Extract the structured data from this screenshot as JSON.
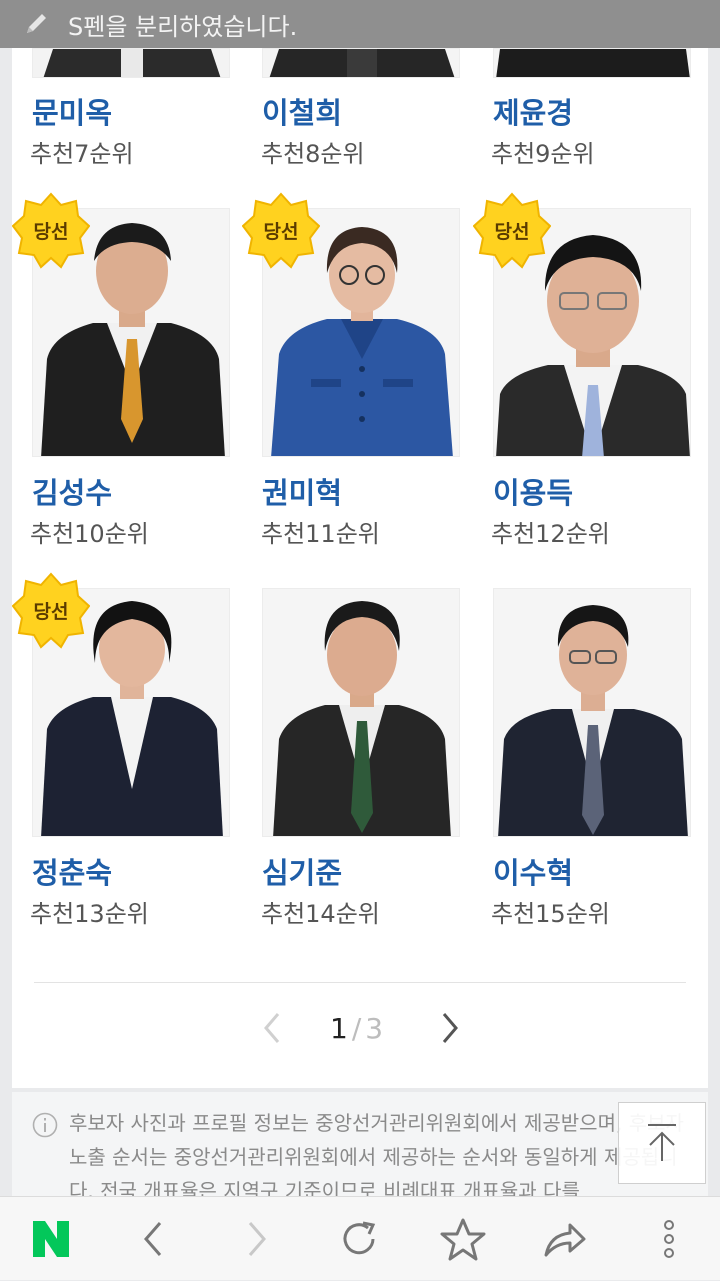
{
  "statusbar": {
    "message": "S펜을 분리하였습니다."
  },
  "candidates": [
    {
      "name": "문미옥",
      "rank": "추천7순위",
      "elected": false
    },
    {
      "name": "이철희",
      "rank": "추천8순위",
      "elected": false
    },
    {
      "name": "제윤경",
      "rank": "추천9순위",
      "elected": false
    },
    {
      "name": "김성수",
      "rank": "추천10순위",
      "elected": true
    },
    {
      "name": "권미혁",
      "rank": "추천11순위",
      "elected": true
    },
    {
      "name": "이용득",
      "rank": "추천12순위",
      "elected": true
    },
    {
      "name": "정춘숙",
      "rank": "추천13순위",
      "elected": true
    },
    {
      "name": "심기준",
      "rank": "추천14순위",
      "elected": false
    },
    {
      "name": "이수혁",
      "rank": "추천15순위",
      "elected": false
    }
  ],
  "badge_label": "당선",
  "pagination": {
    "current": "1",
    "separator": "/",
    "total": "3"
  },
  "notice": {
    "text": "후보자 사진과 프로필 정보는 중앙선거관리위원회에서 제공받으며, 후보자 노출 순서는 중앙선거관리위원회에서 제공하는 순서와 동일하게 제공됩니다. 전국 개표율은 지역구 기준이므로 비례대표 개표율과 다를"
  },
  "colors": {
    "name": "#1f5ea8",
    "badge": "#ffd21f",
    "naver_green": "#03c75a"
  },
  "icons": [
    "pen-icon",
    "info-icon",
    "arrow-up-icon",
    "naver-logo",
    "back-icon",
    "forward-icon",
    "refresh-icon",
    "star-icon",
    "share-icon",
    "more-icon"
  ]
}
